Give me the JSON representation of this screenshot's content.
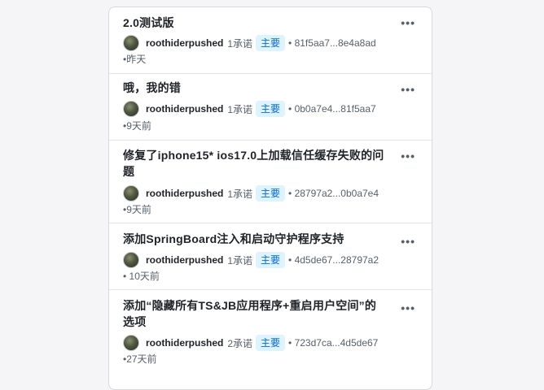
{
  "commits": [
    {
      "title": "2.0测试版",
      "author": "roothiderpushed",
      "count": "1承诺",
      "badge": "主要",
      "hash": "• 81f5aa7...8e4a8ad",
      "time": "•昨天"
    },
    {
      "title": "哦，我的错",
      "author": "roothiderpushed",
      "count": "1承诺",
      "badge": "主要",
      "hash": "• 0b0a7e4...81f5aa7",
      "time": "•9天前"
    },
    {
      "title": "修复了iphone15* ios17.0上加载信任缓存失败的问题",
      "author": "roothiderpushed",
      "count": "1承诺",
      "badge": "主要",
      "hash": "• 28797a2...0b0a7e4",
      "time": "•9天前"
    },
    {
      "title": "添加SpringBoard注入和启动守护程序支持",
      "author": "roothiderpushed",
      "count": "1承诺",
      "badge": "主要",
      "hash": "• 4d5de67...28797a2",
      "time": "• 10天前"
    },
    {
      "title": "添加“隐藏所有TS&JB应用程序+重启用户空间”的选项",
      "author": "roothiderpushed",
      "count": "2承诺",
      "badge": "主要",
      "hash": "• 723d7ca...4d5de67",
      "time": "•27天前"
    }
  ],
  "more_label": "•••",
  "icons": {
    "more": "kebab-horizontal-icon",
    "avatar": "user-avatar"
  },
  "colors": {
    "badge_text": "#0969da",
    "badge_bg": "#ddf4ff",
    "title_text": "#1f2328",
    "muted_text": "#57606a"
  }
}
